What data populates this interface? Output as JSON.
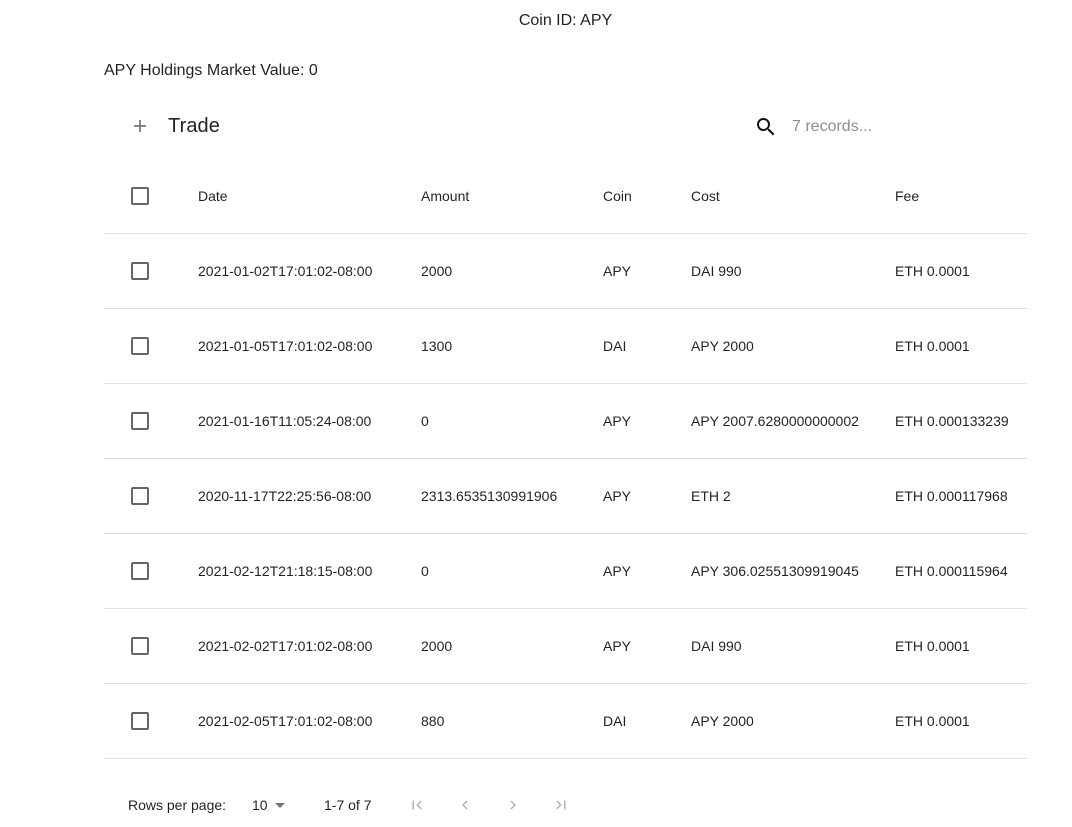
{
  "header": {
    "coin_title": "Coin ID: APY",
    "market_value": "APY Holdings Market Value: 0"
  },
  "toolbar": {
    "trade_label": "Trade",
    "search_placeholder": "7 records...",
    "add_icon": "plus-icon",
    "search_icon": "search-icon"
  },
  "table": {
    "columns": [
      "Date",
      "Amount",
      "Coin",
      "Cost",
      "Fee"
    ],
    "rows": [
      {
        "date": "2021-01-02T17:01:02-08:00",
        "amount": "2000",
        "coin": "APY",
        "cost": "DAI 990",
        "fee": "ETH 0.0001"
      },
      {
        "date": "2021-01-05T17:01:02-08:00",
        "amount": "1300",
        "coin": "DAI",
        "cost": "APY 2000",
        "fee": "ETH 0.0001"
      },
      {
        "date": "2021-01-16T11:05:24-08:00",
        "amount": "0",
        "coin": "APY",
        "cost": "APY 2007.6280000000002",
        "fee": "ETH 0.000133239"
      },
      {
        "date": "2020-11-17T22:25:56-08:00",
        "amount": "2313.6535130991906",
        "coin": "APY",
        "cost": "ETH 2",
        "fee": "ETH 0.000117968"
      },
      {
        "date": "2021-02-12T21:18:15-08:00",
        "amount": "0",
        "coin": "APY",
        "cost": "APY 306.02551309919045",
        "fee": "ETH 0.000115964"
      },
      {
        "date": "2021-02-02T17:01:02-08:00",
        "amount": "2000",
        "coin": "APY",
        "cost": "DAI 990",
        "fee": "ETH 0.0001"
      },
      {
        "date": "2021-02-05T17:01:02-08:00",
        "amount": "880",
        "coin": "DAI",
        "cost": "APY 2000",
        "fee": "ETH 0.0001"
      }
    ]
  },
  "pagination": {
    "rows_per_page_label": "Rows per page:",
    "rows_per_page_value": "10",
    "range": "1-7 of 7",
    "icons": [
      "first-page-icon",
      "previous-page-icon",
      "next-page-icon",
      "last-page-icon"
    ]
  }
}
